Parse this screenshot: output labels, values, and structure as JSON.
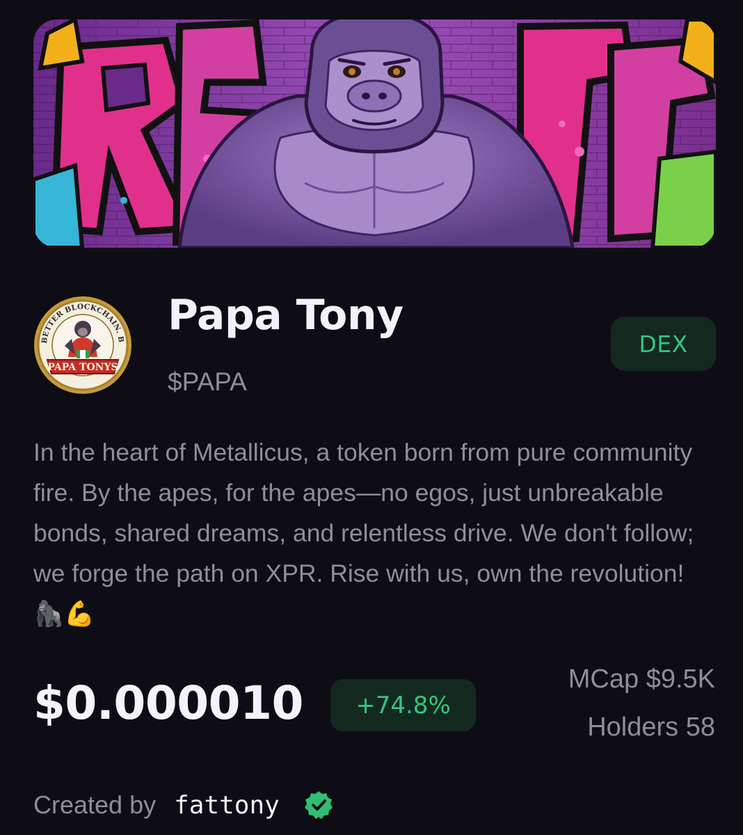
{
  "banner": {
    "alt": "Purple gorilla in front of graffiti wall"
  },
  "logo": {
    "ring_text_top": "BETTER BLOCKCHAIN. BETTER CRYPTO.",
    "ribbon_text": "PAPA TONYS"
  },
  "token": {
    "name": "Papa Tony",
    "symbol": "$PAPA",
    "badge": "DEX",
    "description": "In the heart of Metallicus, a token born from pure community fire. By the apes, for the apes—no egos, just unbreakable bonds, shared dreams, and relentless drive. We don't follow; we forge the path on XPR. Rise with us, own the revolution! 🦍💪"
  },
  "stats": {
    "price": "$0.000010",
    "change": "+74.8%",
    "mcap": "MCap $9.5K",
    "holders": "Holders 58"
  },
  "creator": {
    "label": "Created by",
    "name": "fattony",
    "verified_icon": "verified-check-icon"
  },
  "colors": {
    "background": "#0e0d15",
    "positive": "#34c67e",
    "badge_bg": "#13291f",
    "muted_text": "#8e8d9b"
  }
}
